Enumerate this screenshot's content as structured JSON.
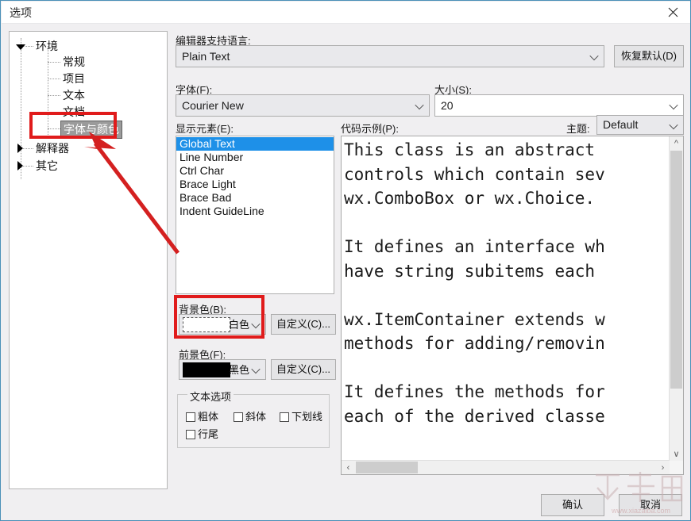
{
  "window": {
    "title": "选项",
    "close_icon": "close-icon"
  },
  "tree": {
    "nodes": [
      {
        "label": "环境",
        "state": "expanded"
      },
      {
        "label": "常规",
        "state": "leaf"
      },
      {
        "label": "项目",
        "state": "leaf"
      },
      {
        "label": "文本",
        "state": "leaf"
      },
      {
        "label": "文档",
        "state": "leaf"
      },
      {
        "label": "字体与颜色",
        "state": "leaf-selected"
      },
      {
        "label": "解释器",
        "state": "collapsed"
      },
      {
        "label": "其它",
        "state": "collapsed"
      }
    ],
    "selected": "字体与颜色"
  },
  "form": {
    "language_label": "编辑器支持语言:",
    "language_value": "Plain Text",
    "reset_button": "恢复默认(D)",
    "font_label": "字体(F):",
    "font_value": "Courier New",
    "size_label": "大小(S):",
    "size_value": "20",
    "elements_label": "显示元素(E):",
    "elements": [
      "Global Text",
      "Line Number",
      "Ctrl Char",
      "Brace Light",
      "Brace Bad",
      "Indent GuideLine"
    ],
    "elements_selected": "Global Text",
    "sample_label": "代码示例(P):",
    "theme_label": "主题:",
    "theme_value": "Default",
    "background_label": "背景色(B):",
    "background_value": "白色",
    "background_color": "#ffffff",
    "background_custom_button": "自定义(C)...",
    "foreground_label": "前景色(F):",
    "foreground_value": "黑色",
    "foreground_color": "#000000",
    "foreground_custom_button": "自定义(C)...",
    "text_options_title": "文本选项",
    "text_options": [
      {
        "label": "粗体",
        "checked": false
      },
      {
        "label": "斜体",
        "checked": false
      },
      {
        "label": "下划线",
        "checked": false
      },
      {
        "label": "行尾",
        "checked": false
      }
    ]
  },
  "code_sample": {
    "text": "This class is an abstract\ncontrols which contain sev\nwx.ComboBox or wx.Choice.\n\nIt defines an interface wh\nhave string subitems each\n\nwx.ItemContainer extends w\nmethods for adding/removin\n\nIt defines the methods for\neach of the derived classe"
  },
  "footer": {
    "ok_button": "确认",
    "cancel_button": "取消"
  },
  "watermark": {
    "logo_text": "下载吧",
    "url": "www.xiazaiba.com"
  }
}
